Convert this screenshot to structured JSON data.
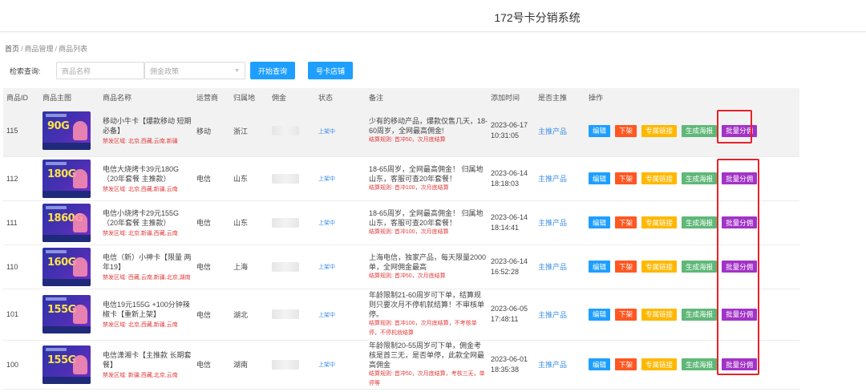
{
  "app_title": "172号卡分销系统",
  "breadcrumb": [
    "首页",
    "商品管理",
    "商品列表"
  ],
  "search": {
    "label": "检索查询:",
    "name_placeholder": "商品名称",
    "policy_placeholder": "佣金政策",
    "search_button": "开始查询",
    "shop_button": "号卡店铺"
  },
  "table": {
    "headers": [
      "商品ID",
      "商品主图",
      "商品名称",
      "运营商",
      "归属地",
      "佣金",
      "状态",
      "备注",
      "添加时间",
      "是否主推",
      "操作"
    ],
    "actions": {
      "edit": "编辑",
      "down": "下架",
      "link": "专属链接",
      "poster": "生成海报",
      "batch": "批量分佣"
    },
    "rows": [
      {
        "id": "115",
        "thumb_label": "90G",
        "name": "移动小牛卡【爆款移动 短期必备】",
        "ban": "禁发区域: 北京,西藏,云南,新疆",
        "carrier": "移动",
        "region": "浙江",
        "status": "上架中",
        "remark": "少有的移动产品，爆款仅售几天，18-60周岁，全网最高佣金!",
        "remark_red": "结算规则: 首冲50，次月底结算",
        "time": "2023-06-17 10:31:05",
        "main_push": "主推产品"
      },
      {
        "id": "112",
        "thumb_label": "180G",
        "name": "电信大烧烤卡39元180G（20年套餐 主推款）",
        "ban": "禁发区域: 北京,西藏,新疆,云南",
        "carrier": "电信",
        "region": "山东",
        "status": "上架中",
        "remark": "18-65周岁，全网最高佣金！ 归属地山东，客服可查20年套餐！",
        "remark_red": "结算规则: 首冲100，次月底结算",
        "time": "2023-06-14 18:18:03",
        "main_push": "主推产品"
      },
      {
        "id": "111",
        "thumb_label": "1860G",
        "name": "电信小烧烤卡29元155G（20年套餐 主推款）",
        "ban": "禁发区域: 北京,新疆,西藏,云南",
        "carrier": "电信",
        "region": "山东",
        "status": "上架中",
        "remark": "18-65周岁，全网最高佣金！ 归属地山东，客服可查20年套餐！",
        "remark_red": "结算规则: 首冲100，次月底结算",
        "time": "2023-06-14 18:14:41",
        "main_push": "主推产品"
      },
      {
        "id": "110",
        "thumb_label": "160G",
        "name": "电信（新）小神卡【限量 两年19】",
        "ban": "禁发区域: 西藏,云南,新疆,北京,湖南",
        "carrier": "电信",
        "region": "上海",
        "status": "上架中",
        "remark": "上海电信，独家产品，每天限量2000单，全网佣金最高",
        "remark_red": "结算规则: 首冲50，次月底结算",
        "time": "2023-06-14 16:52:28",
        "main_push": "主推产品"
      },
      {
        "id": "101",
        "thumb_label": "155G",
        "name": "电信19元155G +100分钟辣椒卡【重新上架】",
        "ban": "禁发区域: 北京,西藏,新疆,云南",
        "carrier": "电信",
        "region": "湖北",
        "status": "上架中",
        "remark": "年龄限制21-60周岁可下单，结算规则只要次月不停机就结算！不审核单停。",
        "remark_red": "结算规则: 首冲100，次月底结算，不考核单停，不停机就结算",
        "time": "2023-06-05 17:48:11",
        "main_push": "主推产品"
      },
      {
        "id": "100",
        "thumb_label": "155G",
        "name": "电信潇湘卡【主推款 长期套餐】",
        "ban": "禁发区域: 新疆,西藏,北京,云南",
        "carrier": "电信",
        "region": "湖南",
        "status": "上架中",
        "remark": "年龄限制20-55周岁可下单，佣金考核是首三无，是否单停，此款全网最高佣金",
        "remark_red": "结算规则: 首冲50，次月底结算，考核三无，单停等",
        "time": "2023-06-01 18:35:38",
        "main_push": "主推产品"
      }
    ]
  },
  "colors": {
    "edit": "#1e9fff",
    "down": "#ff5722",
    "link": "#ffb800",
    "poster": "#5fb878",
    "batch": "#a233c6",
    "highlight_box": "#e8212b"
  }
}
